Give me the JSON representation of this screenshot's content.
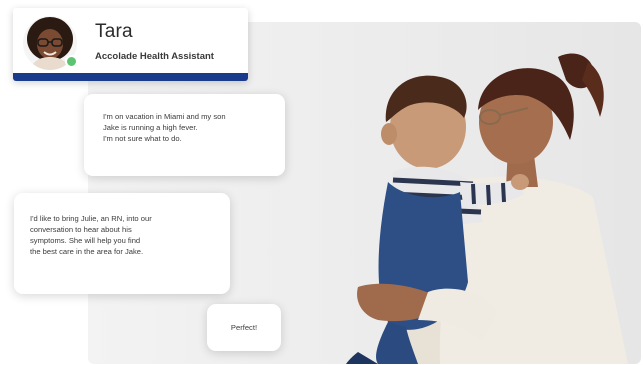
{
  "assistant": {
    "name": "Tara",
    "role": "Accolade Health Assistant",
    "status": "online",
    "accent_color": "#1a3a8c",
    "status_color": "#5cc471"
  },
  "messages": [
    {
      "sender": "user",
      "lines": [
        "I'm on vacation in Miami and my son",
        "Jake is running a high fever.",
        "I'm not sure what to do."
      ]
    },
    {
      "sender": "assistant",
      "lines": [
        "I'd like to bring Julie, an RN, into our",
        "conversation to hear about his",
        "symptoms. She will help you find",
        "the best care in the area for Jake."
      ]
    },
    {
      "sender": "user",
      "lines": [
        "Perfect!"
      ]
    }
  ],
  "background": {
    "icon": "mother-and-child-photo"
  }
}
